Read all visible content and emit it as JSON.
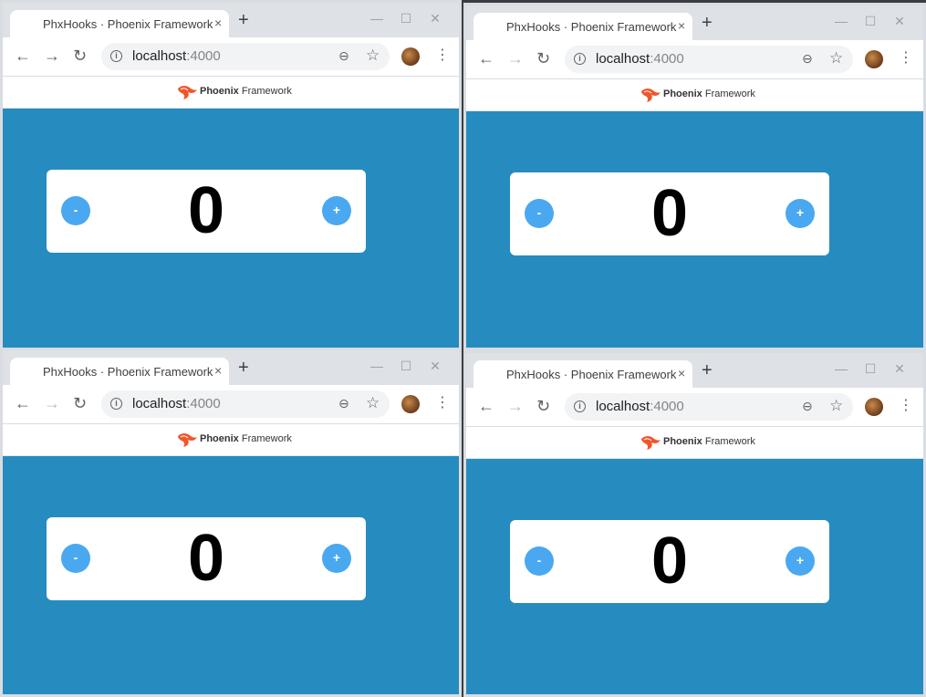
{
  "browser": {
    "tab_title": "PhxHooks · Phoenix Framework",
    "tab_close": "×",
    "new_tab": "+",
    "window_buttons": {
      "minimize": "—",
      "maximize": "☐",
      "close": "✕"
    },
    "url_host": "localhost",
    "url_port": ":4000"
  },
  "header": {
    "logo_bold": "Phoenix",
    "logo_light": " Framework"
  },
  "counter": {
    "minus_label": "-",
    "plus_label": "+",
    "values": [
      "0",
      "0",
      "0",
      "0"
    ]
  },
  "icons": {
    "back": "arrow-left-icon",
    "forward": "arrow-right-icon",
    "reload": "reload-icon",
    "info": "info-icon",
    "zoom": "zoom-out-icon",
    "star": "star-icon",
    "menu": "kebab-menu-icon"
  },
  "colors": {
    "content_bg": "#268bbf",
    "button_bg": "#4aa8f0",
    "card_bg": "#ffffff",
    "logo": "#f0562c"
  }
}
